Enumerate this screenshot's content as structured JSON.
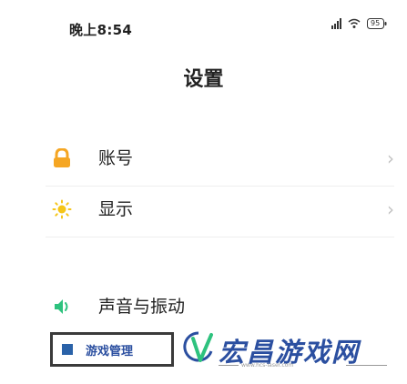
{
  "status_bar": {
    "time": "晚上8:54",
    "battery": "95"
  },
  "page_title": "设置",
  "settings": {
    "items": [
      {
        "label": "账号",
        "icon": "lock-icon",
        "color": "#f5a623"
      },
      {
        "label": "显示",
        "icon": "brightness-icon",
        "color": "#f5c518"
      },
      {
        "label": "声音与振动",
        "icon": "sound-icon",
        "color": "#2ec27e"
      }
    ]
  },
  "watermark": {
    "box_text": "游戏管理",
    "brand": "宏昌游戏网",
    "url": "www.hcs-laser.com",
    "brand_color": "#2b4fa0"
  }
}
